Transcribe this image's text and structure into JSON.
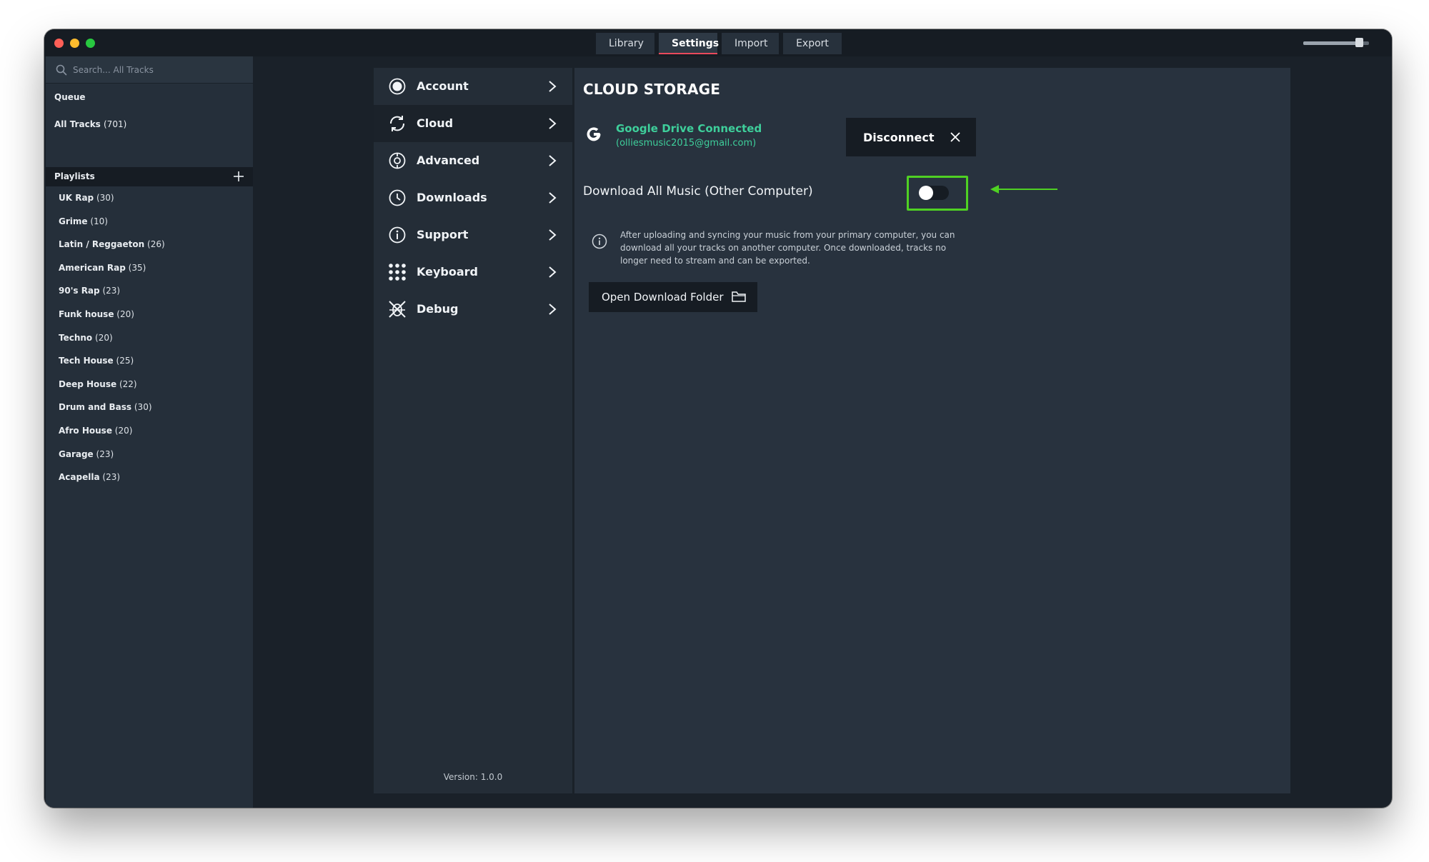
{
  "tabs": [
    {
      "label": "Library"
    },
    {
      "label": "Settings",
      "active": true
    },
    {
      "label": "Import"
    },
    {
      "label": "Export"
    }
  ],
  "volume": {
    "level": 0.9
  },
  "sidebar": {
    "search_placeholder": "Search... All Tracks",
    "queue_label": "Queue",
    "all_tracks_label": "All Tracks",
    "all_tracks_count": "(701)",
    "playlists_header": "Playlists",
    "playlists": [
      {
        "name": "UK Rap",
        "count": "(30)"
      },
      {
        "name": "Grime",
        "count": "(10)"
      },
      {
        "name": "Latin / Reggaeton",
        "count": "(26)"
      },
      {
        "name": "American Rap",
        "count": "(35)"
      },
      {
        "name": "90's Rap",
        "count": "(23)"
      },
      {
        "name": "Funk house",
        "count": "(20)"
      },
      {
        "name": "Techno",
        "count": "(20)"
      },
      {
        "name": "Tech House",
        "count": "(25)"
      },
      {
        "name": "Deep House",
        "count": "(22)"
      },
      {
        "name": "Drum and Bass",
        "count": "(30)"
      },
      {
        "name": "Afro House",
        "count": "(20)"
      },
      {
        "name": "Garage",
        "count": "(23)"
      },
      {
        "name": "Acapella",
        "count": "(23)"
      }
    ]
  },
  "settings_menu": {
    "items": [
      {
        "label": "Account",
        "icon": "account-icon"
      },
      {
        "label": "Cloud",
        "icon": "cloud-sync-icon",
        "active": true
      },
      {
        "label": "Advanced",
        "icon": "advanced-icon"
      },
      {
        "label": "Downloads",
        "icon": "downloads-icon"
      },
      {
        "label": "Support",
        "icon": "info-icon"
      },
      {
        "label": "Keyboard",
        "icon": "keyboard-grid-icon"
      },
      {
        "label": "Debug",
        "icon": "debug-icon"
      }
    ],
    "version": "Version: 1.0.0"
  },
  "cloud": {
    "title": "CLOUD STORAGE",
    "gdrive_status": "Google Drive Connected",
    "gdrive_email": "(olliesmusic2015@gmail.com)",
    "disconnect_label": "Disconnect",
    "download_all_label": "Download All Music (Other Computer)",
    "download_all_enabled": false,
    "info_text": "After uploading and syncing your music from your primary computer, you can download all your tracks on another computer. Once downloaded, tracks no longer need to stream and can be exported.",
    "open_folder_label": "Open Download Folder"
  },
  "colors": {
    "accent_tab": "#e94a5c",
    "connected_green": "#3ecf9b",
    "highlight_green": "#4fd123"
  }
}
